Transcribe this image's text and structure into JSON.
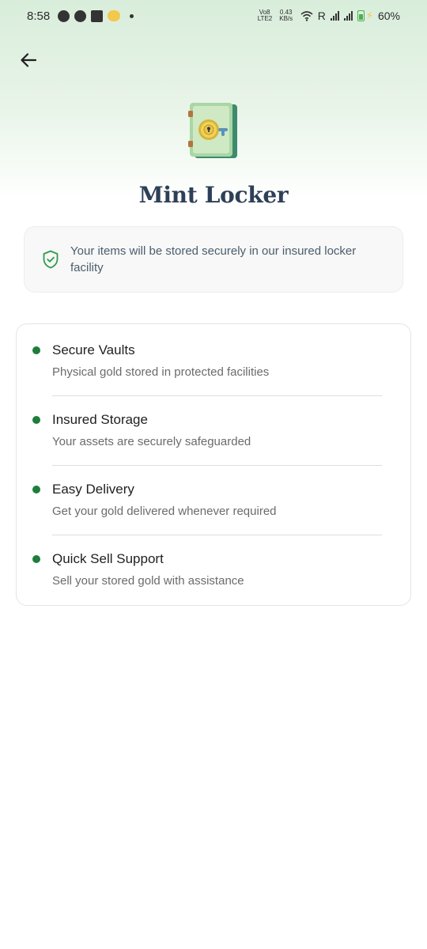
{
  "status_bar": {
    "time": "8:58",
    "network_label": "Vo8\nLTE2",
    "speed_value": "0.43",
    "speed_unit": "KB/s",
    "roaming": "R",
    "battery": "60%"
  },
  "header": {
    "back_icon": "arrow-left-icon",
    "title": "Mint Locker"
  },
  "notice": {
    "icon": "shield-check-icon",
    "text": "Your items will be stored securely in our insured locker facility"
  },
  "features": [
    {
      "title": "Secure Vaults",
      "description": "Physical gold stored in protected facilities"
    },
    {
      "title": "Insured Storage",
      "description": "Your assets are securely safeguarded"
    },
    {
      "title": "Easy Delivery",
      "description": "Get your gold delivered whenever required"
    },
    {
      "title": "Quick Sell Support",
      "description": "Sell your stored gold with assistance"
    }
  ],
  "colors": {
    "title": "#2e4057",
    "accent_green": "#1e7d3a",
    "header_gradient": "#d9eddb"
  }
}
